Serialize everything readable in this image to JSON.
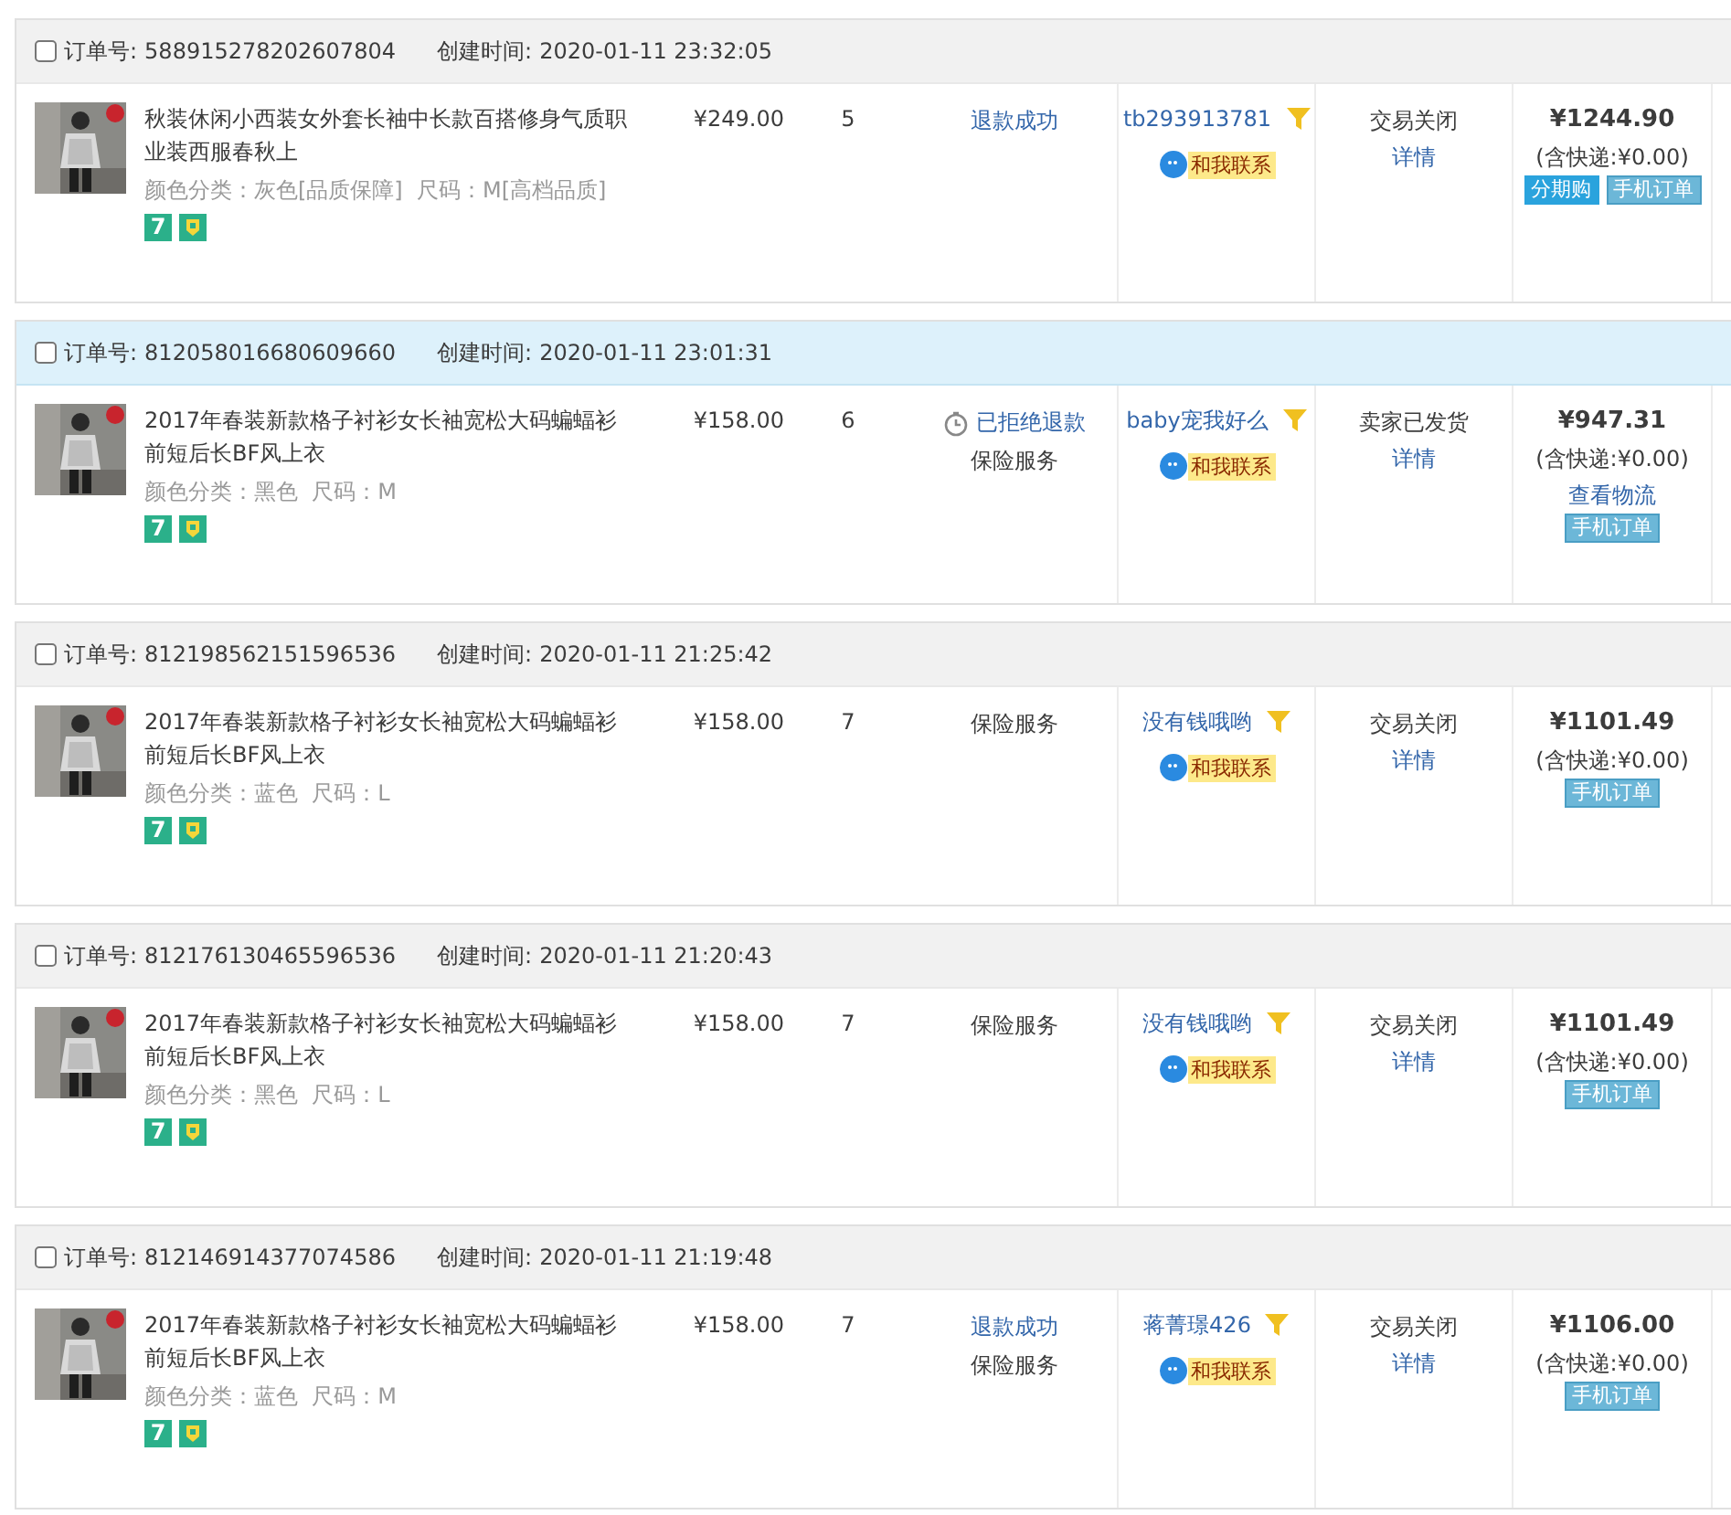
{
  "orders": [
    {
      "order_no_label": "订单号:",
      "order_no": "588915278202607804",
      "created_label": "创建时间:",
      "created": "2020-01-11 23:32:05",
      "highlighted": false,
      "checked": false,
      "item": {
        "title": "秋装休闲小西装女外套长袖中长款百搭修身气质职业装西服春秋上",
        "attrs": "颜色分类：灰色[品质保障]  尺码：M[高档品质]",
        "service_badge": "7",
        "price": "¥249.00",
        "qty": "5"
      },
      "refund": [
        {
          "kind": "link",
          "text": "退款成功"
        }
      ],
      "seller": {
        "name": "tb293913781",
        "contact": "和我联系"
      },
      "status": {
        "text": "交易关闭",
        "detail": "详情"
      },
      "total": {
        "amount": "¥1244.90",
        "shipping": "(含快递:¥0.00)",
        "badges": [
          {
            "kind": "installment",
            "label": "分期购"
          },
          {
            "kind": "mobile",
            "label": "手机订单"
          }
        ]
      }
    },
    {
      "order_no_label": "订单号:",
      "order_no": "812058016680609660",
      "created_label": "创建时间:",
      "created": "2020-01-11 23:01:31",
      "highlighted": true,
      "checked": false,
      "item": {
        "title": "2017年春装新款格子衬衫女长袖宽松大码蝙蝠衫前短后长BF风上衣",
        "attrs": "颜色分类：黑色  尺码：M",
        "service_badge": "7",
        "price": "¥158.00",
        "qty": "6"
      },
      "refund": [
        {
          "kind": "rejected",
          "text": "已拒绝退款"
        },
        {
          "kind": "plain",
          "text": "保险服务"
        }
      ],
      "seller": {
        "name": "baby宠我好么",
        "contact": "和我联系"
      },
      "status": {
        "text": "卖家已发货",
        "detail": "详情"
      },
      "total": {
        "amount": "¥947.31",
        "shipping": "(含快递:¥0.00)",
        "link": "查看物流",
        "badges": [
          {
            "kind": "mobile",
            "label": "手机订单"
          }
        ]
      }
    },
    {
      "order_no_label": "订单号:",
      "order_no": "812198562151596536",
      "created_label": "创建时间:",
      "created": "2020-01-11 21:25:42",
      "highlighted": false,
      "checked": false,
      "item": {
        "title": "2017年春装新款格子衬衫女长袖宽松大码蝙蝠衫前短后长BF风上衣",
        "attrs": "颜色分类：蓝色  尺码：L",
        "service_badge": "7",
        "price": "¥158.00",
        "qty": "7"
      },
      "refund": [
        {
          "kind": "plain",
          "text": "保险服务"
        }
      ],
      "seller": {
        "name": "没有钱哦哟",
        "contact": "和我联系"
      },
      "status": {
        "text": "交易关闭",
        "detail": "详情"
      },
      "total": {
        "amount": "¥1101.49",
        "shipping": "(含快递:¥0.00)",
        "badges": [
          {
            "kind": "mobile",
            "label": "手机订单"
          }
        ]
      }
    },
    {
      "order_no_label": "订单号:",
      "order_no": "812176130465596536",
      "created_label": "创建时间:",
      "created": "2020-01-11 21:20:43",
      "highlighted": false,
      "checked": false,
      "item": {
        "title": "2017年春装新款格子衬衫女长袖宽松大码蝙蝠衫前短后长BF风上衣",
        "attrs": "颜色分类：黑色  尺码：L",
        "service_badge": "7",
        "price": "¥158.00",
        "qty": "7"
      },
      "refund": [
        {
          "kind": "plain",
          "text": "保险服务"
        }
      ],
      "seller": {
        "name": "没有钱哦哟",
        "contact": "和我联系"
      },
      "status": {
        "text": "交易关闭",
        "detail": "详情"
      },
      "total": {
        "amount": "¥1101.49",
        "shipping": "(含快递:¥0.00)",
        "badges": [
          {
            "kind": "mobile",
            "label": "手机订单"
          }
        ]
      }
    },
    {
      "order_no_label": "订单号:",
      "order_no": "812146914377074586",
      "created_label": "创建时间:",
      "created": "2020-01-11 21:19:48",
      "highlighted": false,
      "checked": false,
      "item": {
        "title": "2017年春装新款格子衬衫女长袖宽松大码蝙蝠衫前短后长BF风上衣",
        "attrs": "颜色分类：蓝色  尺码：M",
        "service_badge": "7",
        "price": "¥158.00",
        "qty": "7"
      },
      "refund": [
        {
          "kind": "link",
          "text": "退款成功"
        },
        {
          "kind": "plain",
          "text": "保险服务"
        }
      ],
      "seller": {
        "name": "蒋菁璟426",
        "contact": "和我联系"
      },
      "status": {
        "text": "交易关闭",
        "detail": "详情"
      },
      "total": {
        "amount": "¥1106.00",
        "shipping": "(含快递:¥0.00)",
        "badges": [
          {
            "kind": "mobile",
            "label": "手机订单"
          }
        ]
      }
    }
  ]
}
